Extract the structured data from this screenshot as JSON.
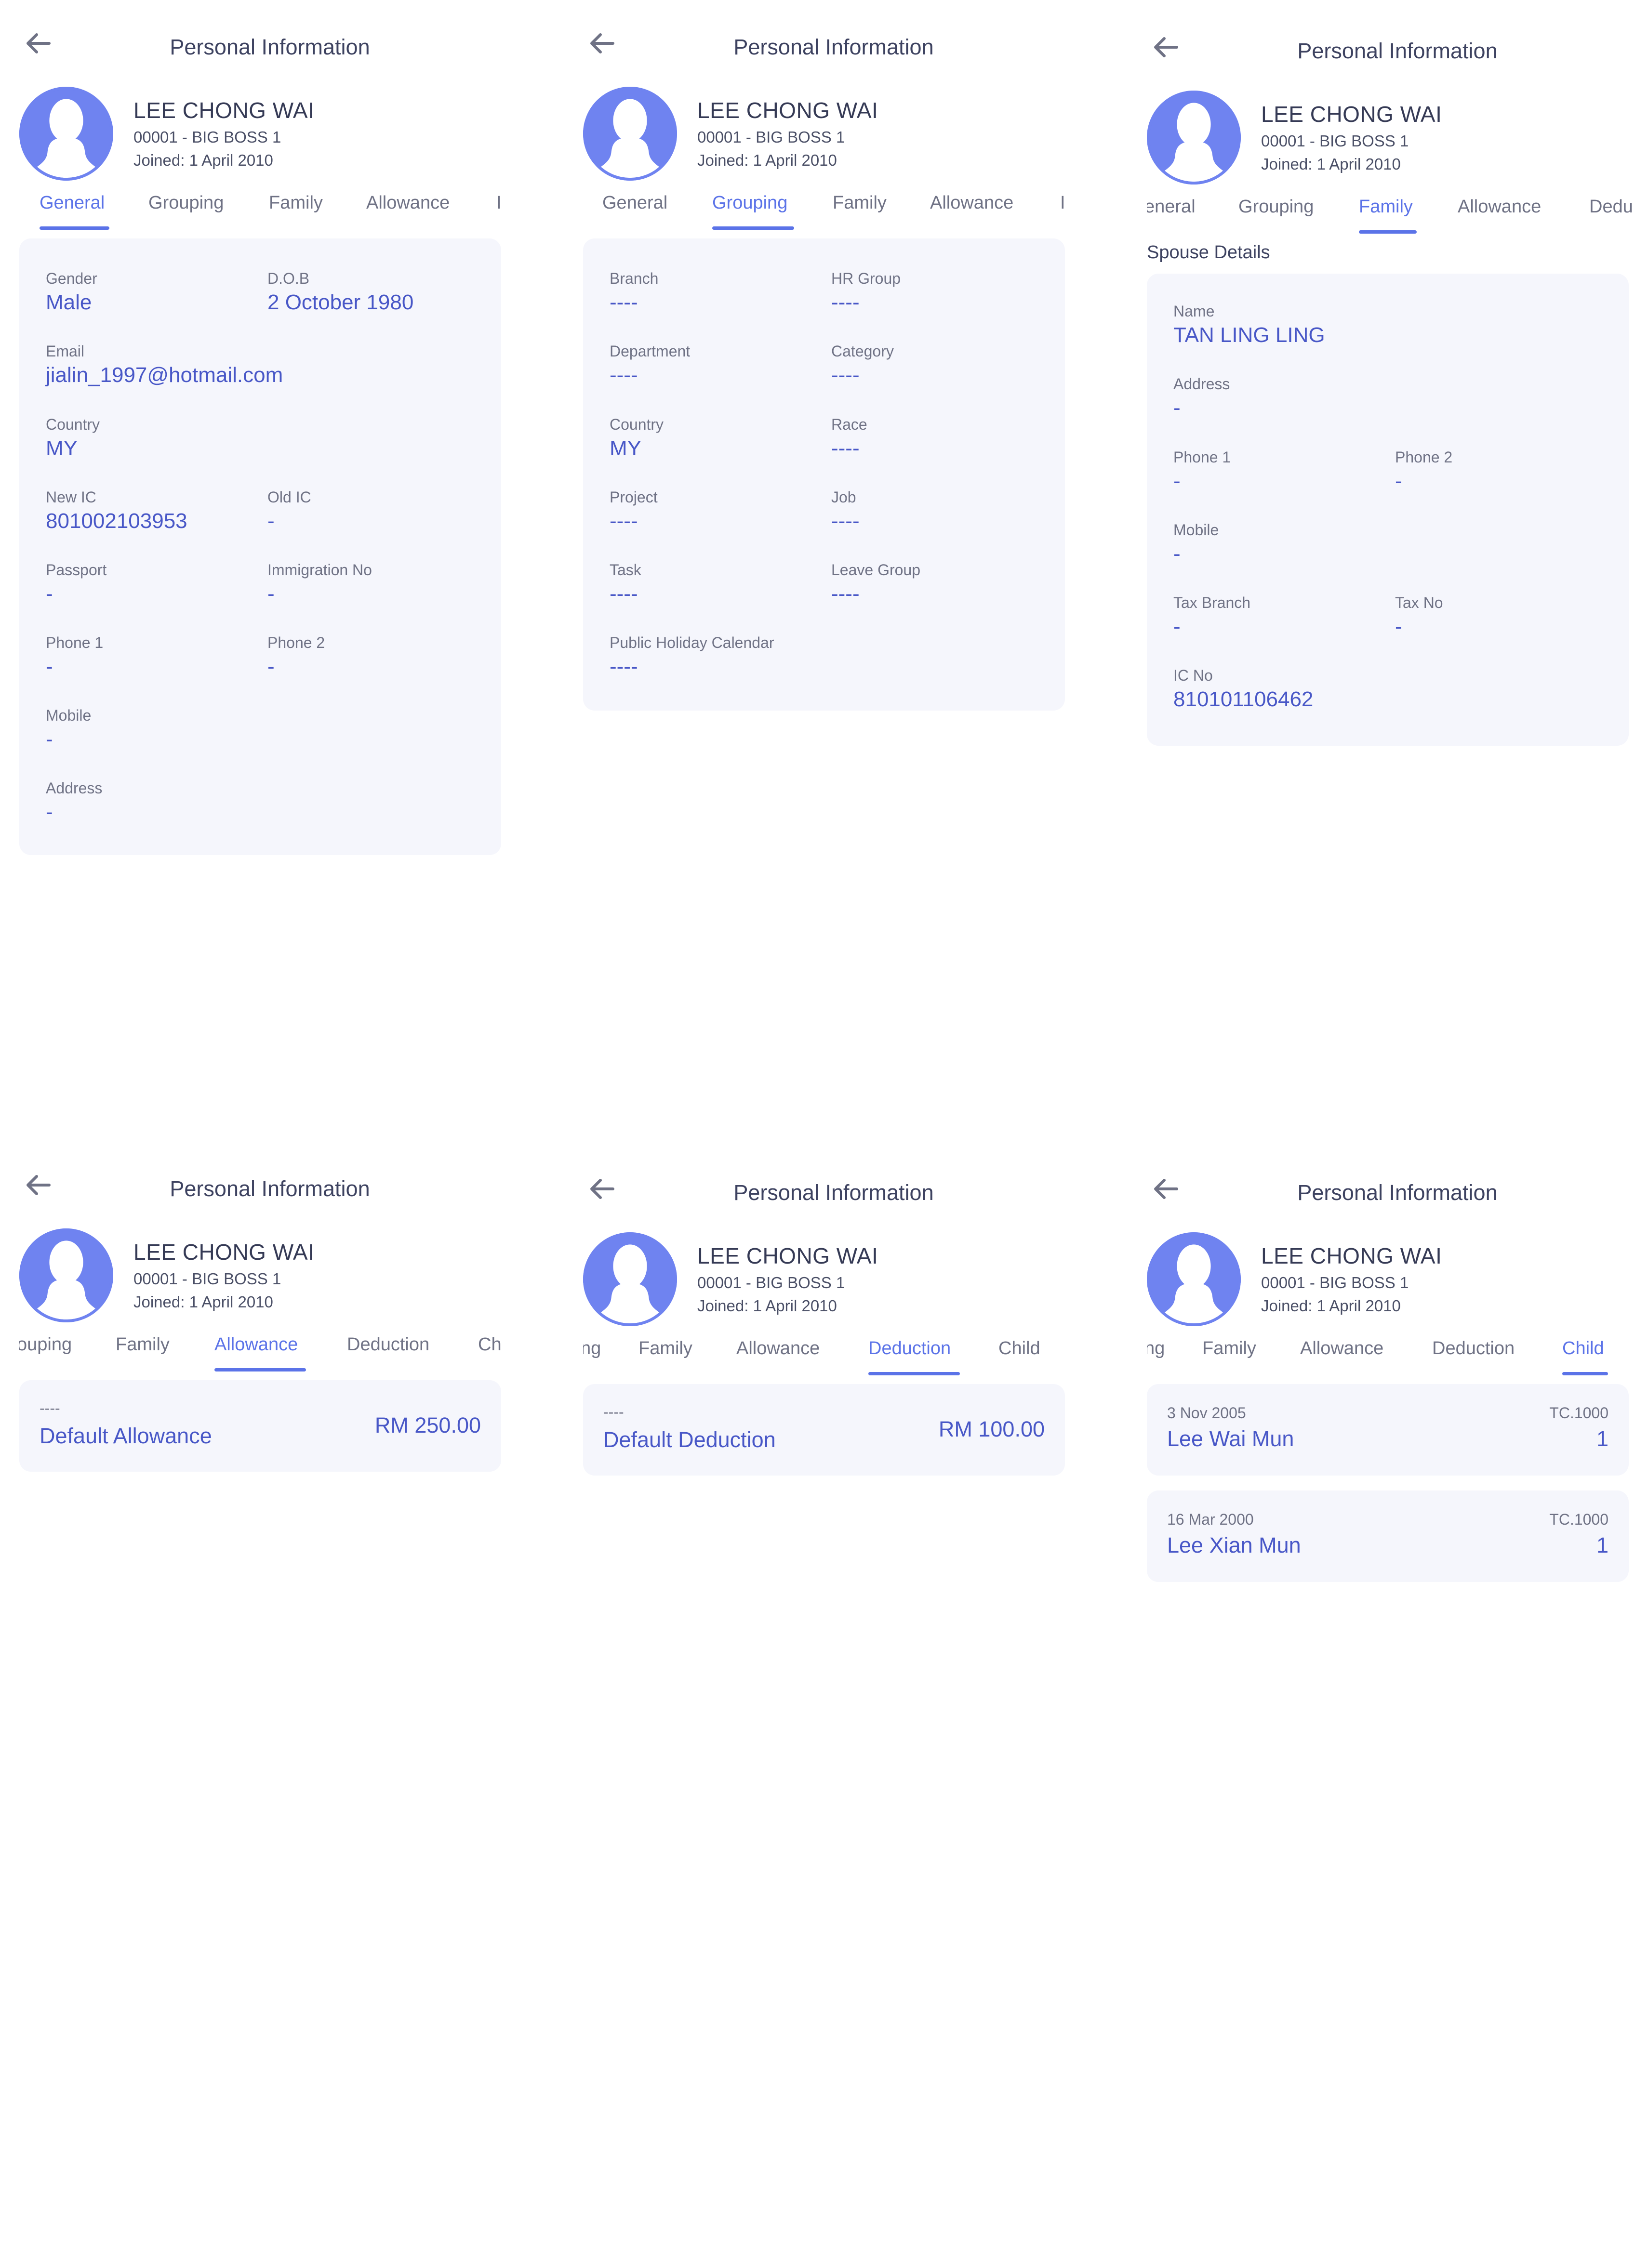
{
  "common": {
    "title": "Personal Information",
    "name": "LEE CHONG WAI",
    "code": "00001 - BIG BOSS 1",
    "joined": "Joined: 1 April 2010"
  },
  "tabs": {
    "general": "General",
    "grouping": "Grouping",
    "family": "Family",
    "allowance": "Allowance",
    "deduction": "Deduction",
    "child": "Child"
  },
  "tab_fragments": {
    "p1_next": "I",
    "p2_next": "I",
    "p3_prev": "eneral",
    "p3_next": "Dedu",
    "p4_prev": "ouping",
    "p4_next": "Ch",
    "p5_prev": "ng",
    "p6_prev": "ng"
  },
  "general": {
    "gender_label": "Gender",
    "gender": "Male",
    "dob_label": "D.O.B",
    "dob": "2 October 1980",
    "email_label": "Email",
    "email": "jialin_1997@hotmail.com",
    "country_label": "Country",
    "country": "MY",
    "new_ic_label": "New IC",
    "new_ic": "801002103953",
    "old_ic_label": "Old IC",
    "old_ic": "-",
    "passport_label": "Passport",
    "passport": "-",
    "immigration_label": "Immigration No",
    "immigration": "-",
    "phone1_label": "Phone 1",
    "phone1": "-",
    "phone2_label": "Phone 2",
    "phone2": "-",
    "mobile_label": "Mobile",
    "mobile": "-",
    "address_label": "Address",
    "address": "-"
  },
  "grouping": {
    "branch_label": "Branch",
    "branch": "----",
    "hr_group_label": "HR Group",
    "hr_group": "----",
    "department_label": "Department",
    "department": "----",
    "category_label": "Category",
    "category": "----",
    "country_label": "Country",
    "country": "MY",
    "race_label": "Race",
    "race": "----",
    "project_label": "Project",
    "project": "----",
    "job_label": "Job",
    "job": "----",
    "task_label": "Task",
    "task": "----",
    "leave_group_label": "Leave Group",
    "leave_group": "----",
    "holiday_label": "Public Holiday Calendar",
    "holiday": "----"
  },
  "family": {
    "section_title": "Spouse Details",
    "name_label": "Name",
    "name": "TAN LING LING",
    "address_label": "Address",
    "address": "-",
    "phone1_label": "Phone 1",
    "phone1": "-",
    "phone2_label": "Phone 2",
    "phone2": "-",
    "mobile_label": "Mobile",
    "mobile": "-",
    "tax_branch_label": "Tax Branch",
    "tax_branch": "-",
    "tax_no_label": "Tax No",
    "tax_no": "-",
    "ic_label": "IC No",
    "ic": "810101106462"
  },
  "allowance": {
    "items": [
      {
        "code": "----",
        "name": "Default Allowance",
        "amount": "RM 250.00"
      }
    ]
  },
  "deduction": {
    "items": [
      {
        "code": "----",
        "name": "Default Deduction",
        "amount": "RM 100.00"
      }
    ]
  },
  "child": {
    "items": [
      {
        "date": "3 Nov 2005",
        "name": "Lee Wai Mun",
        "code": "TC.1000",
        "number": "1"
      },
      {
        "date": "16 Mar 2000",
        "name": "Lee Xian Mun",
        "code": "TC.1000",
        "number": "1"
      }
    ]
  },
  "colors": {
    "accent": "#5b73e8",
    "value": "#4857c7",
    "card": "#f5f6fc",
    "avatar": "#6f83f0"
  }
}
